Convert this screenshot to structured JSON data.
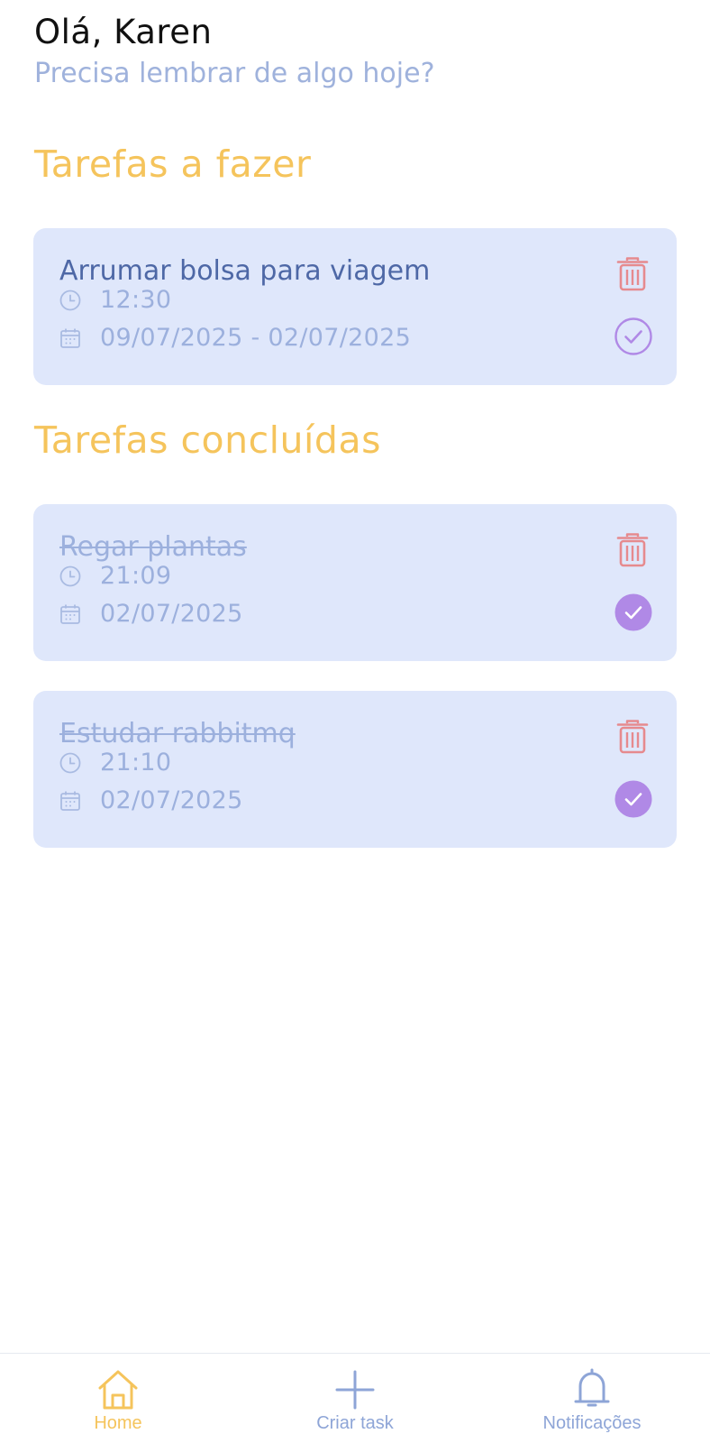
{
  "header": {
    "greeting": "Olá, Karen",
    "subtitle": "Precisa lembrar de algo hoje?"
  },
  "sections": {
    "todo_title": "Tarefas a fazer",
    "done_title": "Tarefas concluídas"
  },
  "tasks": [
    {
      "title": "Arrumar bolsa para viagem",
      "time": "12:30",
      "date": "09/07/2025 - 02/07/2025",
      "completed": false
    },
    {
      "title": "Regar plantas",
      "time": "21:09",
      "date": "02/07/2025",
      "completed": true
    },
    {
      "title": "Estudar rabbitmq",
      "time": "21:10",
      "date": "02/07/2025",
      "completed": true
    }
  ],
  "icons": {
    "time": "clock-icon",
    "date": "calendar-icon",
    "delete": "trash-icon",
    "complete": "check-circle-icon"
  },
  "tabbar": {
    "items": [
      {
        "label": "Home",
        "icon": "home-icon",
        "active": true
      },
      {
        "label": "Criar task",
        "icon": "plus-icon",
        "active": false
      },
      {
        "label": "Notificações",
        "icon": "bell-icon",
        "active": false
      }
    ]
  },
  "colors": {
    "accent": "#f5c45c",
    "card_bg": "#dfe7fb",
    "title_active": "#4e68a6",
    "muted": "#9cb0dd",
    "delete": "#e68a8e",
    "check": "#b089e6",
    "tab_inactive": "#8ea5d7"
  }
}
